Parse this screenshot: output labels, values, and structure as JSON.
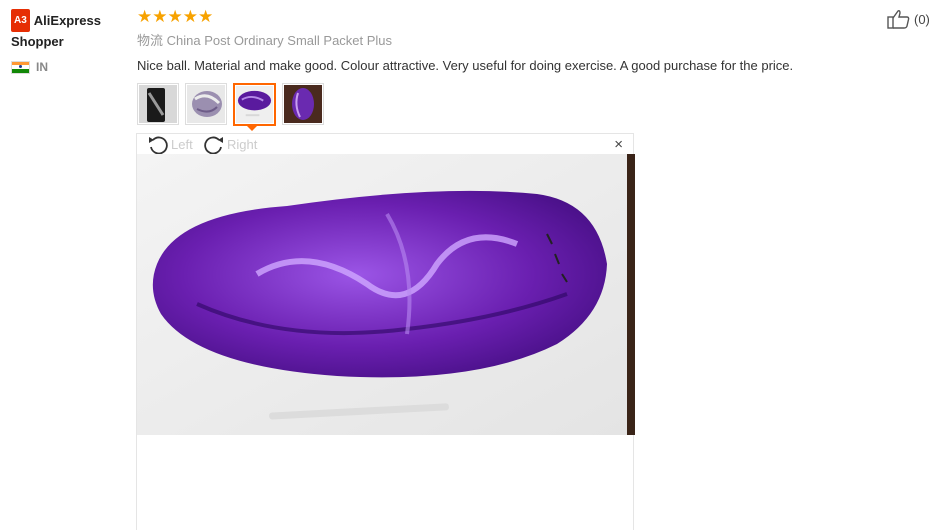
{
  "user": {
    "badge": "A3",
    "name": "AliExpress Shopper",
    "country_code": "IN"
  },
  "review": {
    "rating_stars": "★★★★★",
    "rating": 5,
    "shipping": "物流 China Post Ordinary Small Packet Plus",
    "text": "Nice ball. Material and make good. Colour attractive. Very useful for doing exercise. A good purchase for the price.",
    "helpful_count": "(0)"
  },
  "thumbnails": [
    {
      "icon": "phone-photo-thumbnail"
    },
    {
      "icon": "silver-ball-thumbnail"
    },
    {
      "icon": "purple-ball-thumbnail",
      "active": true
    },
    {
      "icon": "purple-ball-box-thumbnail"
    }
  ],
  "viewer": {
    "rotate_left_label": "Left",
    "rotate_right_label": "Right",
    "close_label": "×"
  },
  "colors": {
    "accent": "#f60",
    "star": "#f7a200",
    "badge": "#e62e04",
    "ball": "#6a1fb0"
  }
}
